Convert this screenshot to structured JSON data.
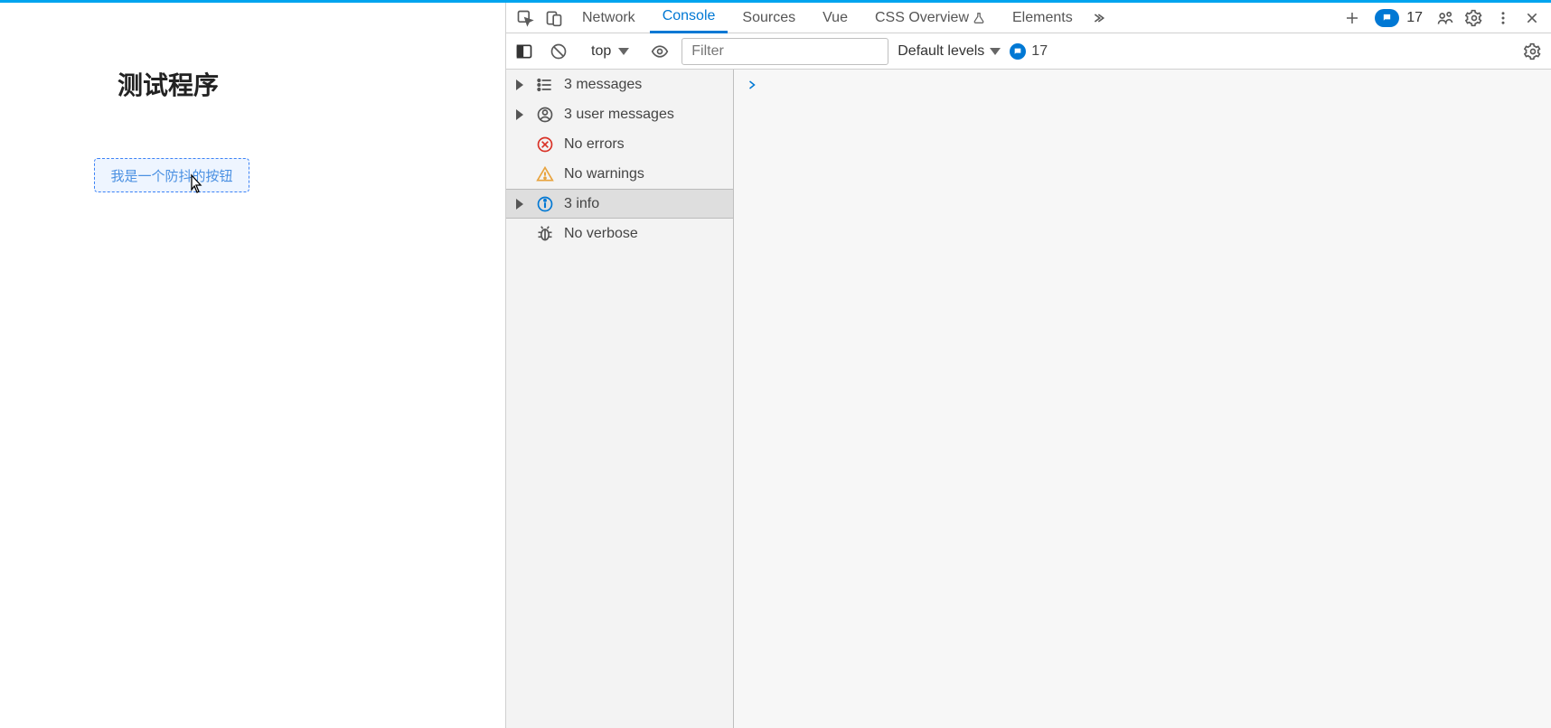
{
  "page": {
    "title": "测试程序",
    "button_label": "我是一个防抖的按钮"
  },
  "devtools": {
    "tabs": {
      "network": "Network",
      "console": "Console",
      "sources": "Sources",
      "vue": "Vue",
      "css_overview": "CSS Overview",
      "elements": "Elements"
    },
    "issues_count": "17",
    "console_toolbar": {
      "context": "top",
      "filter_placeholder": "Filter",
      "levels_label": "Default levels",
      "issue_count": "17"
    },
    "sidebar": {
      "messages": "3 messages",
      "user_messages": "3 user messages",
      "errors": "No errors",
      "warnings": "No warnings",
      "info": "3 info",
      "verbose": "No verbose"
    }
  }
}
